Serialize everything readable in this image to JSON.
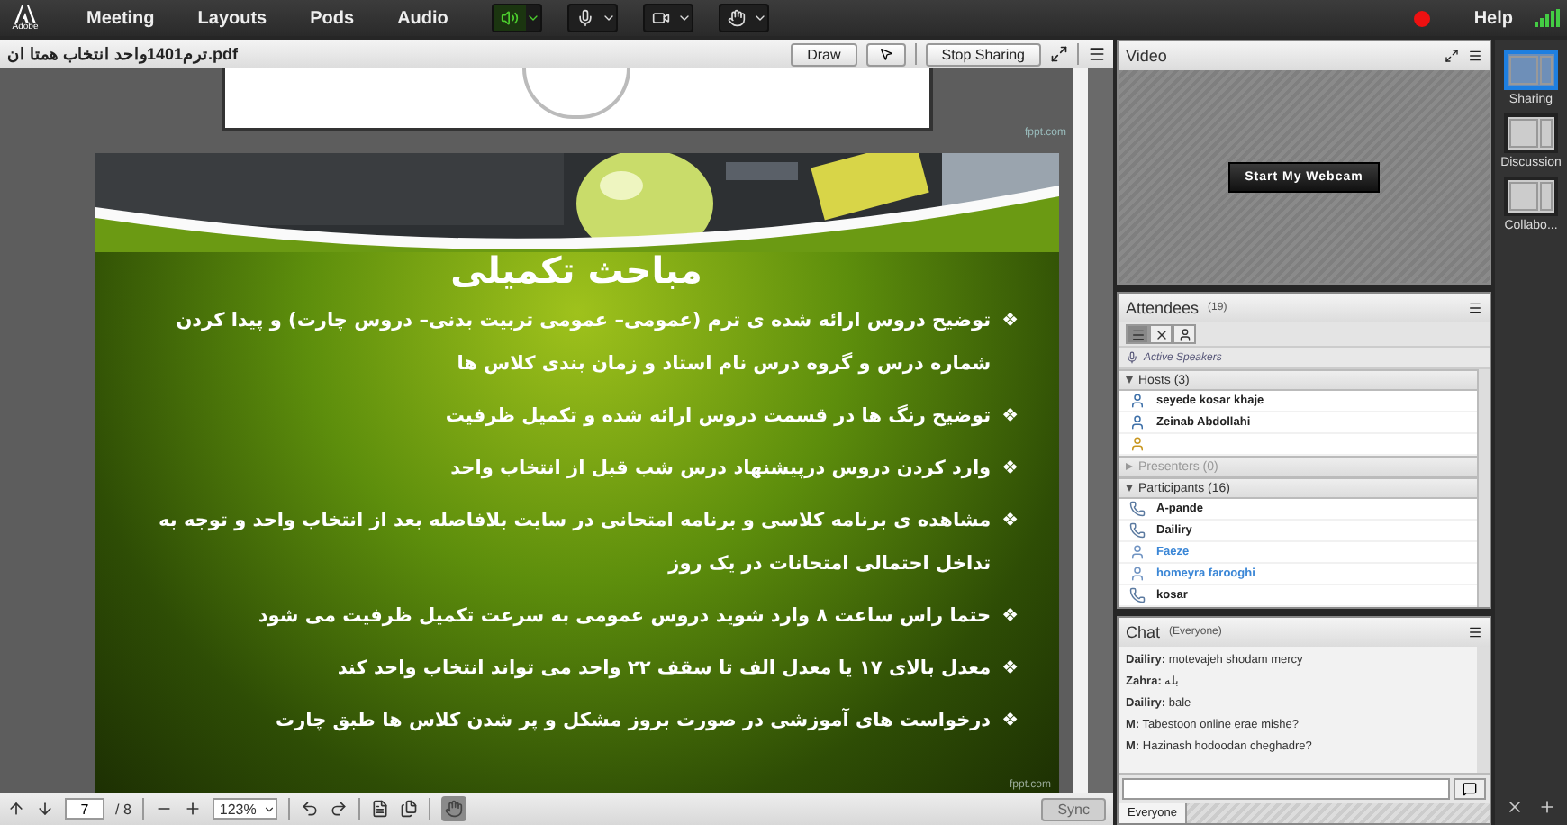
{
  "menubar": {
    "logo": "Adobe",
    "menus": [
      "Meeting",
      "Layouts",
      "Pods",
      "Audio"
    ],
    "audio_controls": [
      {
        "kind": "speaker",
        "on": true
      },
      {
        "kind": "mic",
        "on": false
      },
      {
        "kind": "webcam",
        "on": false
      },
      {
        "kind": "status",
        "on": false
      }
    ],
    "recording": true,
    "help": "Help"
  },
  "share": {
    "filename": "ترم1401واحد انتخاب همتا ان.pdf",
    "draw": "Draw",
    "stop": "Stop Sharing",
    "prev_watermark": "fppt.com",
    "slide": {
      "title": "مباحث تکمیلی",
      "marker": "❖",
      "watermark": "fppt.com",
      "bullets": [
        "توضیح دروس ارائه شده ی ترم (عمومی– عمومی تربیت بدنی– دروس چارت) و پیدا کردن شماره درس و گروه درس نام استاد و زمان بندی کلاس ها",
        "توضیح رنگ ها در قسمت دروس ارائه شده و تکمیل ظرفیت",
        "وارد کردن دروس درپیشنهاد درس شب قبل از انتخاب واحد",
        "مشاهده ی برنامه کلاسی و برنامه امتحانی در سایت بلافاصله بعد از انتخاب واحد و توجه به تداخل احتمالی امتحانات در یک روز",
        "حتما راس ساعت ۸ وارد شوید دروس عمومی  به سرعت تکمیل ظرفیت می شود",
        "معدل بالای ۱۷ یا معدل الف تا سقف ۲۲ واحد می تواند انتخاب واحد کند",
        "درخواست های آموزشی در صورت بروز مشکل و پر شدن کلاس ها طبق چارت"
      ]
    },
    "page": "7",
    "page_total": "/ 8",
    "zoom": "123%",
    "hand_tool": {
      "selected": true
    },
    "sync": "Sync"
  },
  "video": {
    "title": "Video",
    "button": "Start My Webcam"
  },
  "attendees": {
    "title": "Attendees",
    "count": "(19)",
    "active_speakers": "Active Speakers",
    "groups": [
      {
        "label": "Hosts (3)",
        "expanded": true,
        "disabled": false,
        "people": [
          {
            "name": "seyede kosar khaje",
            "kind": "host"
          },
          {
            "name": "Zeinab Abdollahi",
            "kind": "host"
          },
          {
            "kind": "host-away"
          }
        ]
      },
      {
        "label": "Presenters (0)",
        "expanded": false,
        "disabled": true
      },
      {
        "label": "Participants (16)",
        "expanded": true,
        "disabled": false,
        "people": [
          {
            "name": "A-pande",
            "kind": "phone"
          },
          {
            "name": "Dailiry",
            "kind": "phone"
          },
          {
            "name": "Faeze",
            "kind": "participant"
          },
          {
            "name": "homeyra farooghi",
            "kind": "participant"
          },
          {
            "name": "kosar",
            "kind": "phone"
          }
        ]
      }
    ]
  },
  "chat": {
    "title": "Chat",
    "scope": "(Everyone)",
    "messages": [
      {
        "sender": "Dailiry:",
        "text": "motevajeh shodam mercy"
      },
      {
        "sender": "Zahra:",
        "text": "بله"
      },
      {
        "sender": "Dailiry:",
        "text": "bale"
      },
      {
        "sender": "M:",
        "text": "Tabestoon online erae mishe?"
      },
      {
        "sender": "M:",
        "text": "Hazinash hodoodan cheghadre?"
      }
    ],
    "tab": "Everyone"
  },
  "layouts": [
    {
      "label": "Sharing",
      "selected": true
    },
    {
      "label": "Discussion",
      "selected": false
    },
    {
      "label": "Collabo...",
      "selected": false
    }
  ]
}
